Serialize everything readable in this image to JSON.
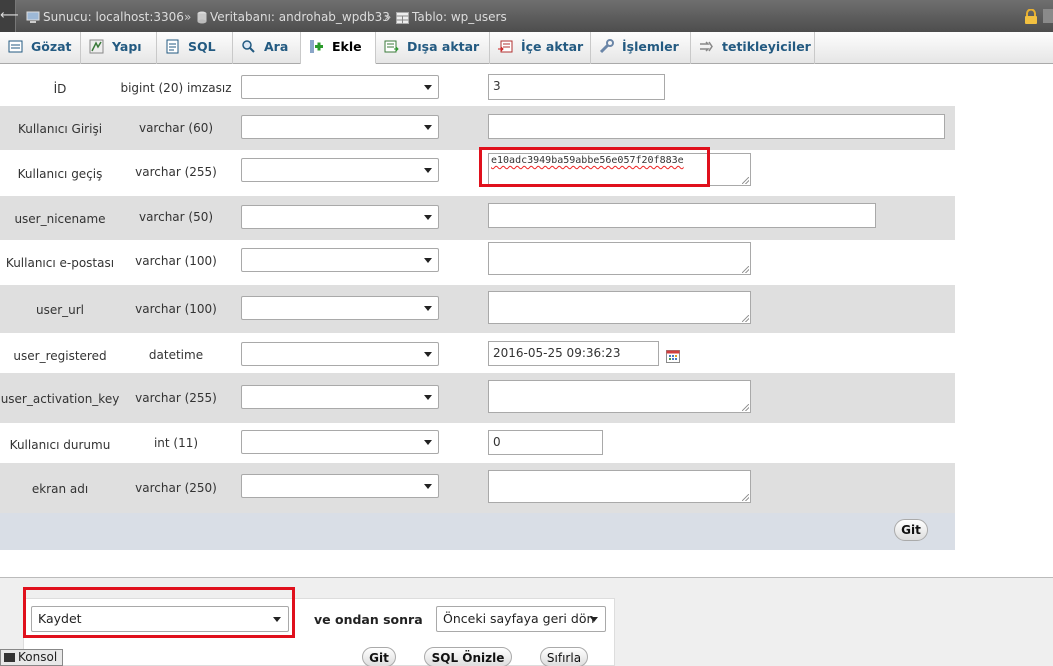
{
  "breadcrumb": {
    "server": "Sunucu: localhost:3306",
    "database": "Veritabanı: androhab_wpdb33",
    "table": "Tablo: wp_users",
    "separator": "»"
  },
  "tabs": [
    {
      "label": "Gözat",
      "icon": "browse-icon"
    },
    {
      "label": "Yapı",
      "icon": "structure-icon"
    },
    {
      "label": "SQL",
      "icon": "sql-icon"
    },
    {
      "label": "Ara",
      "icon": "search-icon"
    },
    {
      "label": "Ekle",
      "icon": "insert-icon",
      "active": true
    },
    {
      "label": "Dışa aktar",
      "icon": "export-icon"
    },
    {
      "label": "İçe aktar",
      "icon": "import-icon"
    },
    {
      "label": "İşlemler",
      "icon": "wrench-icon"
    },
    {
      "label": "tetikleyiciler",
      "icon": "triggers-icon"
    }
  ],
  "fields": [
    {
      "name": "İD",
      "type": "bigint (20) imzasız",
      "value": "3"
    },
    {
      "name": "Kullanıcı Girişi",
      "type": "varchar (60)",
      "value": ""
    },
    {
      "name": "Kullanıcı geçiş",
      "type": "varchar (255)",
      "value": "e10adc3949ba59abbe56e057f20f883e"
    },
    {
      "name": "user_nicename",
      "type": "varchar (50)",
      "value": ""
    },
    {
      "name": "Kullanıcı e-postası",
      "type": "varchar (100)",
      "value": ""
    },
    {
      "name": "user_url",
      "type": "varchar (100)",
      "value": ""
    },
    {
      "name": "user_registered",
      "type": "datetime",
      "value": "2016-05-25 09:36:23"
    },
    {
      "name": "user_activation_key",
      "type": "varchar (255)",
      "value": ""
    },
    {
      "name": "Kullanıcı durumu",
      "type": "int (11)",
      "value": "0"
    },
    {
      "name": "ekran adı",
      "type": "varchar (250)",
      "value": ""
    }
  ],
  "form_go_label": "Git",
  "footer": {
    "action_select": "Kaydet",
    "then_label": "ve ondan sonra",
    "after_select": "Önceki sayfaya geri dön",
    "go_label": "Git",
    "preview_label": "SQL Önizle",
    "reset_label": "Sıfırla"
  },
  "console_label": "Konsol",
  "colors": {
    "highlight": "#e0101c",
    "link": "#235a81"
  }
}
